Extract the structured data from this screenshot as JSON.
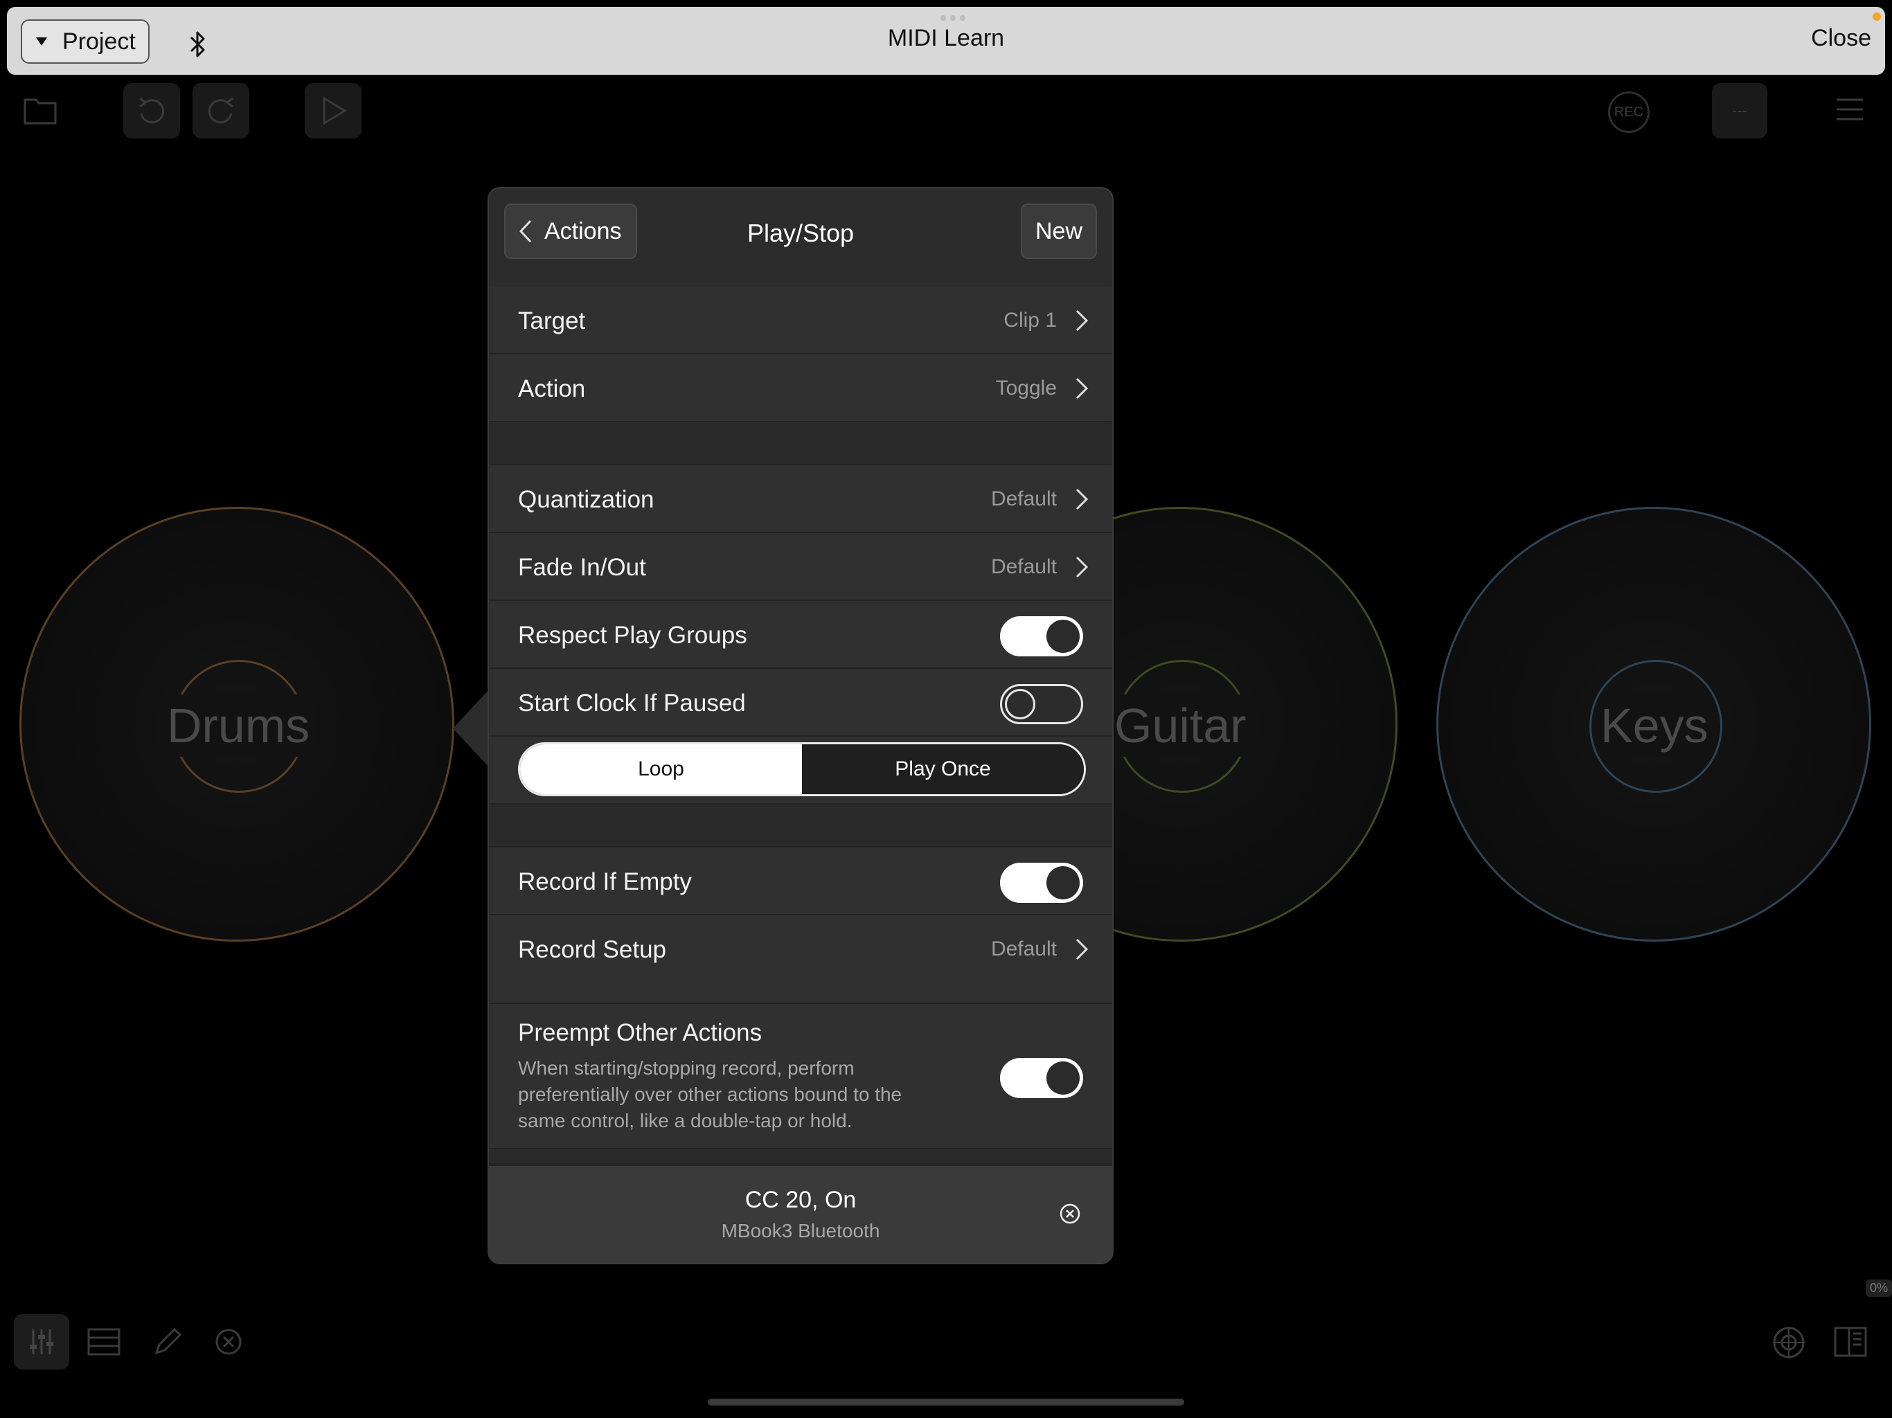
{
  "topbar": {
    "project_label": "Project",
    "title": "MIDI Learn",
    "close_label": "Close"
  },
  "toolbar": {
    "rec_label": "REC",
    "tempo_label": "---"
  },
  "pads": [
    {
      "name": "Drums",
      "color": "#8a5a2a"
    },
    {
      "name": "Guitar",
      "color": "#5f6a2a"
    },
    {
      "name": "Keys",
      "color": "#3a5a72"
    }
  ],
  "popover": {
    "back_label": "Actions",
    "title": "Play/Stop",
    "new_label": "New",
    "target": {
      "label": "Target",
      "value": "Clip 1"
    },
    "action": {
      "label": "Action",
      "value": "Toggle"
    },
    "quantization": {
      "label": "Quantization",
      "value": "Default"
    },
    "fade": {
      "label": "Fade In/Out",
      "value": "Default"
    },
    "respect_play_groups": {
      "label": "Respect Play Groups",
      "on": true
    },
    "start_clock": {
      "label": "Start Clock If Paused",
      "on": false
    },
    "mode": {
      "options": [
        "Loop",
        "Play Once"
      ],
      "selected": "Loop"
    },
    "record_if_empty": {
      "label": "Record If Empty",
      "on": true
    },
    "record_setup": {
      "label": "Record Setup",
      "value": "Default"
    },
    "preempt": {
      "label": "Preempt Other Actions",
      "description": "When starting/stopping record, perform preferentially over other actions bound to the same control, like a double-tap or hold.",
      "on": true
    },
    "binding": {
      "control": "CC 20, On",
      "device": "MBook3 Bluetooth"
    }
  },
  "status": {
    "percent": "0%"
  }
}
